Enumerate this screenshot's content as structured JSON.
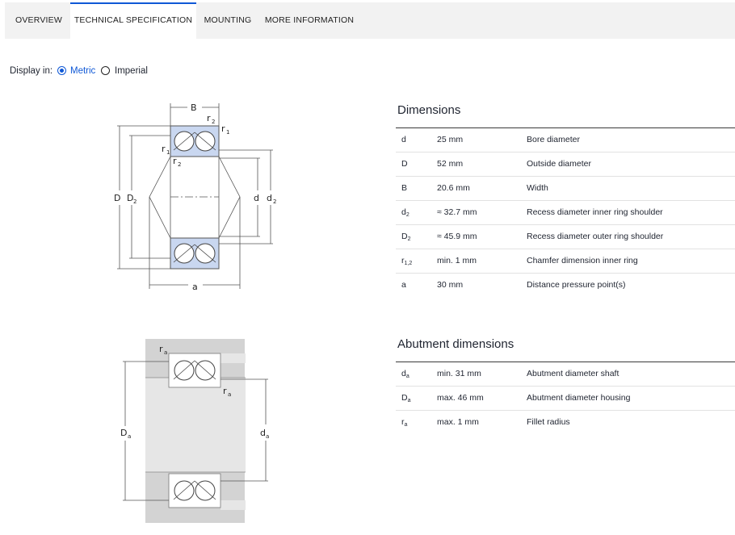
{
  "tabs": [
    {
      "label": "OVERVIEW",
      "active": false
    },
    {
      "label": "TECHNICAL SPECIFICATION",
      "active": true
    },
    {
      "label": "MOUNTING",
      "active": false
    },
    {
      "label": "MORE INFORMATION",
      "active": false
    }
  ],
  "display": {
    "label": "Display in:",
    "options": [
      "Metric",
      "Imperial"
    ],
    "selected": "Metric"
  },
  "dimensions": {
    "title": "Dimensions",
    "rows": [
      {
        "symbol": "d",
        "sub": "",
        "value": "25 mm",
        "description": "Bore diameter"
      },
      {
        "symbol": "D",
        "sub": "",
        "value": "52 mm",
        "description": "Outside diameter"
      },
      {
        "symbol": "B",
        "sub": "",
        "value": "20.6 mm",
        "description": "Width"
      },
      {
        "symbol": "d",
        "sub": "2",
        "value": "≈ 32.7 mm",
        "description": "Recess diameter inner ring shoulder"
      },
      {
        "symbol": "D",
        "sub": "2",
        "value": "≈ 45.9 mm",
        "description": "Recess diameter outer ring shoulder"
      },
      {
        "symbol": "r",
        "sub": "1,2",
        "value": "min. 1 mm",
        "description": "Chamfer dimension inner ring"
      },
      {
        "symbol": "a",
        "sub": "",
        "value": "30 mm",
        "description": "Distance pressure point(s)"
      }
    ]
  },
  "abutment": {
    "title": "Abutment dimensions",
    "rows": [
      {
        "symbol": "d",
        "sub": "a",
        "value": "min. 31 mm",
        "description": "Abutment diameter shaft"
      },
      {
        "symbol": "D",
        "sub": "a",
        "value": "max. 46 mm",
        "description": "Abutment diameter housing"
      },
      {
        "symbol": "r",
        "sub": "a",
        "value": "max. 1 mm",
        "description": "Fillet radius"
      }
    ]
  },
  "diagram_labels": {
    "B": "B",
    "D": "D",
    "D2": "D",
    "d": "d",
    "d2": "d",
    "a": "a",
    "r": "r",
    "sub1": "1",
    "sub2": "2",
    "suba": "a",
    "Da": "D",
    "da": "d",
    "ra": "r"
  },
  "colors": {
    "accent": "#0f58d6",
    "bearing_fill": "#c9d7f0",
    "housing_gray": "#d3d3d3",
    "shaft_gray": "#e6e6e6"
  }
}
